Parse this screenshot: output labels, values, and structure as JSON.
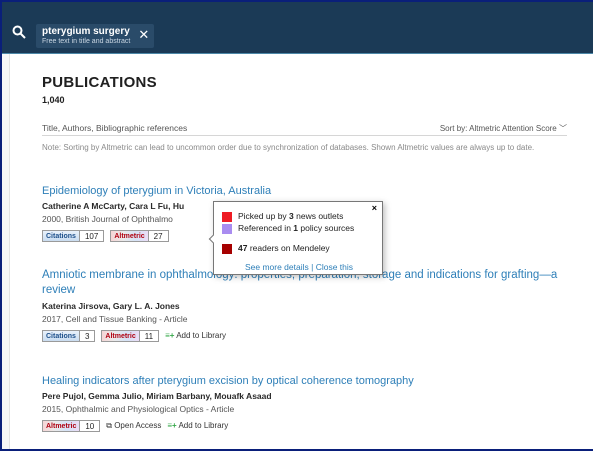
{
  "search": {
    "query": "pterygium surgery",
    "scope": "Free text in title and abstract"
  },
  "publications": {
    "heading": "PUBLICATIONS",
    "count": "1,040",
    "filter_label": "Title, Authors, Bibliographic references",
    "sort_label": "Sort by: Altmetric Attention Score",
    "note": "Note: Sorting by Altmetric can lead to uncommon order due to synchronization of databases. Shown Altmetric values are always up to date."
  },
  "items": [
    {
      "title": "Epidemiology of pterygium in Victoria, Australia",
      "authors": "Catherine A McCarty, Cara L Fu, Hu",
      "meta": "2000, British Journal of Ophthalmo",
      "citations_label": "Citations",
      "citations": "107",
      "altmetric_label": "Altmetric",
      "altmetric": "27"
    },
    {
      "title": "Amniotic membrane in ophthalmology: properties, preparation, storage and indications for grafting—a review",
      "authors": "Katerina Jirsova, Gary L. A. Jones",
      "meta": "2017, Cell and Tissue Banking - Article",
      "citations_label": "Citations",
      "citations": "3",
      "altmetric_label": "Altmetric",
      "altmetric": "11",
      "add_library": "Add to Library"
    },
    {
      "title": "Healing indicators after pterygium excision by optical coherence tomography",
      "authors": "Pere Pujol, Gemma Julio, Miriam Barbany, Mouafk Asaad",
      "meta": "2015, Ophthalmic and Physiological Optics - Article",
      "altmetric_label": "Altmetric",
      "altmetric": "10",
      "open_access": "Open Access",
      "add_library": "Add to Library"
    }
  ],
  "popup": {
    "news_pre": "Picked up by ",
    "news_count": "3",
    "news_post": " news outlets",
    "policy_pre": "Referenced in ",
    "policy_count": "1",
    "policy_post": " policy sources",
    "readers_count": "47",
    "readers_post": " readers on Mendeley",
    "see_details": "See more details",
    "separator": " | ",
    "close_this": "Close this",
    "close_glyph": "×"
  },
  "colors": {
    "news": "#ee1c24",
    "policy": "#a98cf0",
    "mendeley": "#a60000",
    "link": "#2e7fb8",
    "topbar": "#1b3a56"
  }
}
